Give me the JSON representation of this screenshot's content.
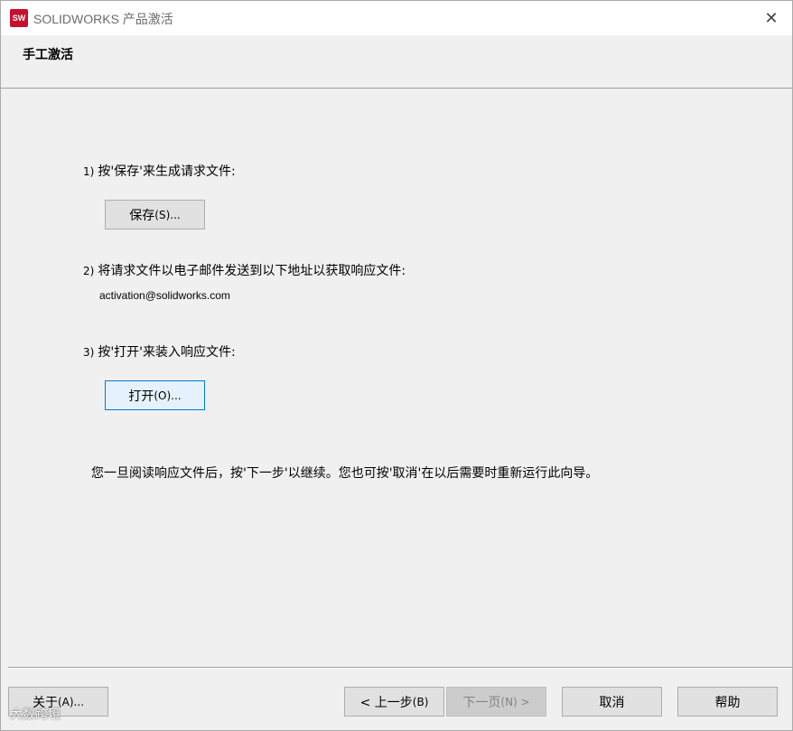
{
  "window": {
    "title": "SOLIDWORKS 产品激活",
    "app_icon_text": "SW",
    "close_glyph": "✕"
  },
  "header": {
    "title": "手工激活"
  },
  "steps": [
    {
      "num": "1)",
      "text": "按'保存'来生成请求文件:"
    },
    {
      "num": "2)",
      "text": "将请求文件以电子邮件发送到以下地址以获取响应文件:"
    },
    {
      "num": "3)",
      "text": "按'打开'来装入响应文件:"
    }
  ],
  "email": "activation@solidworks.com",
  "buttons": {
    "save": {
      "label": "保存",
      "mnemonic": "(S)..."
    },
    "open": {
      "label": "打开",
      "mnemonic": "(O)..."
    },
    "about": {
      "label": "关于",
      "mnemonic": "(A)..."
    },
    "back": {
      "label": "< 上一步",
      "mnemonic": "(B)"
    },
    "next": {
      "label": "下一页",
      "mnemonic": "(N) >"
    },
    "cancel": {
      "label": "取消"
    },
    "help": {
      "label": "帮助"
    }
  },
  "note": "您一旦阅读响应文件后，按'下一步'以继续。您也可按'取消'在以后需要时重新运行此向导。",
  "watermark": "大数跨境",
  "icons": {
    "app": "solidworks-logo-icon",
    "close": "close-icon"
  },
  "colors": {
    "brand": "#c8102e",
    "focus_border": "#0078d7",
    "dialog_bg": "#f0f0f0"
  }
}
